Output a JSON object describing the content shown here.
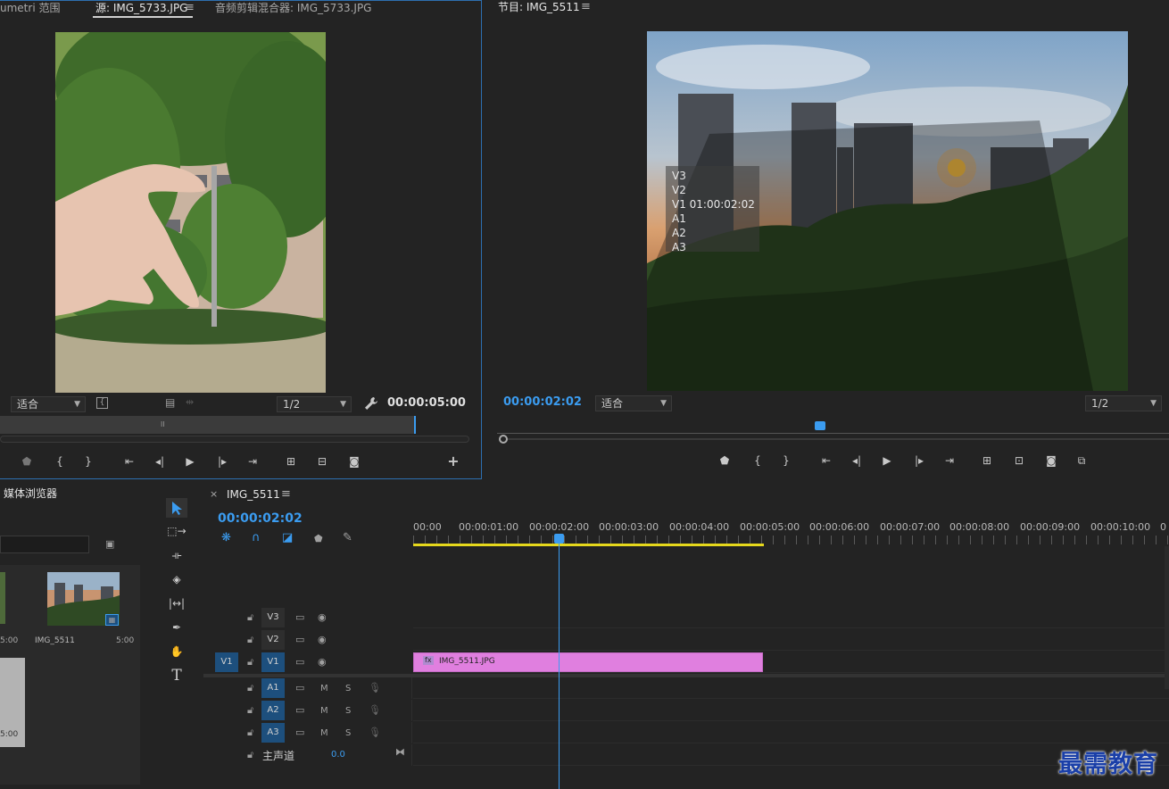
{
  "source_panel": {
    "tab_lumetri": "umetri 范围",
    "tab_source": "源: IMG_5733.JPG",
    "tab_mixer": "音频剪辑混合器: IMG_5733.JPG",
    "fit_label": "适合",
    "zoom_label": "1/2",
    "timecode": "00:00:05:00"
  },
  "program_panel": {
    "tab_program": "节目: IMG_5511",
    "timecode": "00:00:02:02",
    "fit_label": "适合",
    "zoom_label": "1/2",
    "overlay_lines": [
      "V3",
      "V2",
      "V1 01:00:02:02",
      "A1",
      "A2",
      "A3"
    ]
  },
  "media_browser": {
    "tab": "媒体浏览器",
    "clip1_name": "IMG_5511",
    "clip1_duration": "5:00",
    "clip0_duration": "5:00",
    "clip_below_duration": "5:00"
  },
  "timeline": {
    "tab_close": "×",
    "tab_name": "IMG_5511",
    "timecode": "00:00:02:02",
    "ruler": [
      "00:00",
      "00:00:01:00",
      "00:00:02:00",
      "00:00:03:00",
      "00:00:04:00",
      "00:00:05:00",
      "00:00:06:00",
      "00:00:07:00",
      "00:00:08:00",
      "00:00:09:00",
      "00:00:10:00"
    ],
    "ruler_last": "0",
    "clip_name": "IMG_5511.JPG",
    "clip_fx": "fx",
    "video_tracks": [
      "V3",
      "V2",
      "V1"
    ],
    "source_patch_v1": "V1",
    "audio_tracks": [
      "A1",
      "A2",
      "A3"
    ],
    "mute_label": "M",
    "solo_label": "S",
    "master_label": "主声道",
    "master_value": "0.0"
  },
  "watermark": "最需教育",
  "colors": {
    "accent": "#3b9cf0",
    "clip": "#e07fdf",
    "track_sel": "#1d4f7d",
    "work_area": "#e6d81c"
  }
}
